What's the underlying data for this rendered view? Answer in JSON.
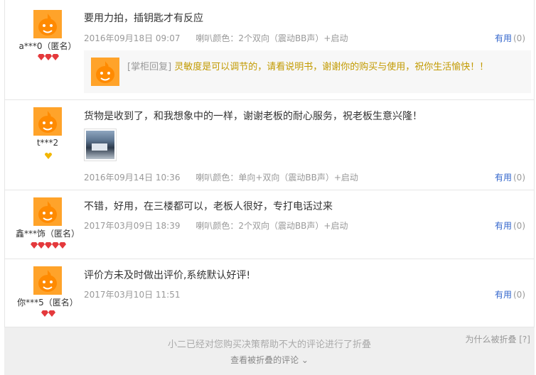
{
  "reviews": [
    {
      "user": "a***0（匿名）",
      "content": "要用力拍，插钥匙才有反应",
      "date": "2016年09月18日 09:07",
      "sku": "喇叭颜色：2个双向（震动BB声）+启动",
      "useful_label": "有用",
      "useful_count": "(0)",
      "reply_tag": "[掌柜回复]",
      "reply": "灵敏度是可以调节的，请看说明书，谢谢你的购买与使用，祝你生活愉快！！",
      "rank": "3 red diamonds"
    },
    {
      "user": "t***2",
      "content": "货物是收到了，和我想象中的一样，谢谢老板的耐心服务，祝老板生意兴隆！",
      "date": "2016年09月14日 10:36",
      "sku": "喇叭颜色：单向+双向（震动BB声）+启动",
      "useful_label": "有用",
      "useful_count": "(0)",
      "rank": "1 yellow heart"
    },
    {
      "user": "鑫***饰（匿名）",
      "content": "不错，好用，在三楼都可以，老板人很好，专打电话过来",
      "date": "2017年03月09日 18:39",
      "sku": "喇叭颜色：2个双向（震动BB声）+启动",
      "useful_label": "有用",
      "useful_count": "(0)",
      "rank": "5 red diamonds"
    },
    {
      "user": "你***5（匿名）",
      "content": "评价方未及时做出评价,系统默认好评!",
      "date": "2017年03月10日 11:51",
      "useful_label": "有用",
      "useful_count": "(0)",
      "rank": "2 red diamonds"
    }
  ],
  "folded": {
    "message": "小二已经对您购买决策帮助不大的评论进行了折叠",
    "link": "查看被折叠的评论 ⌄",
    "why": "为什么被折叠 [?]"
  },
  "colors": {
    "link": "#3366cc",
    "reply": "#c29a00",
    "avatar": "#ffa32a",
    "diamond": "#e4393c"
  }
}
